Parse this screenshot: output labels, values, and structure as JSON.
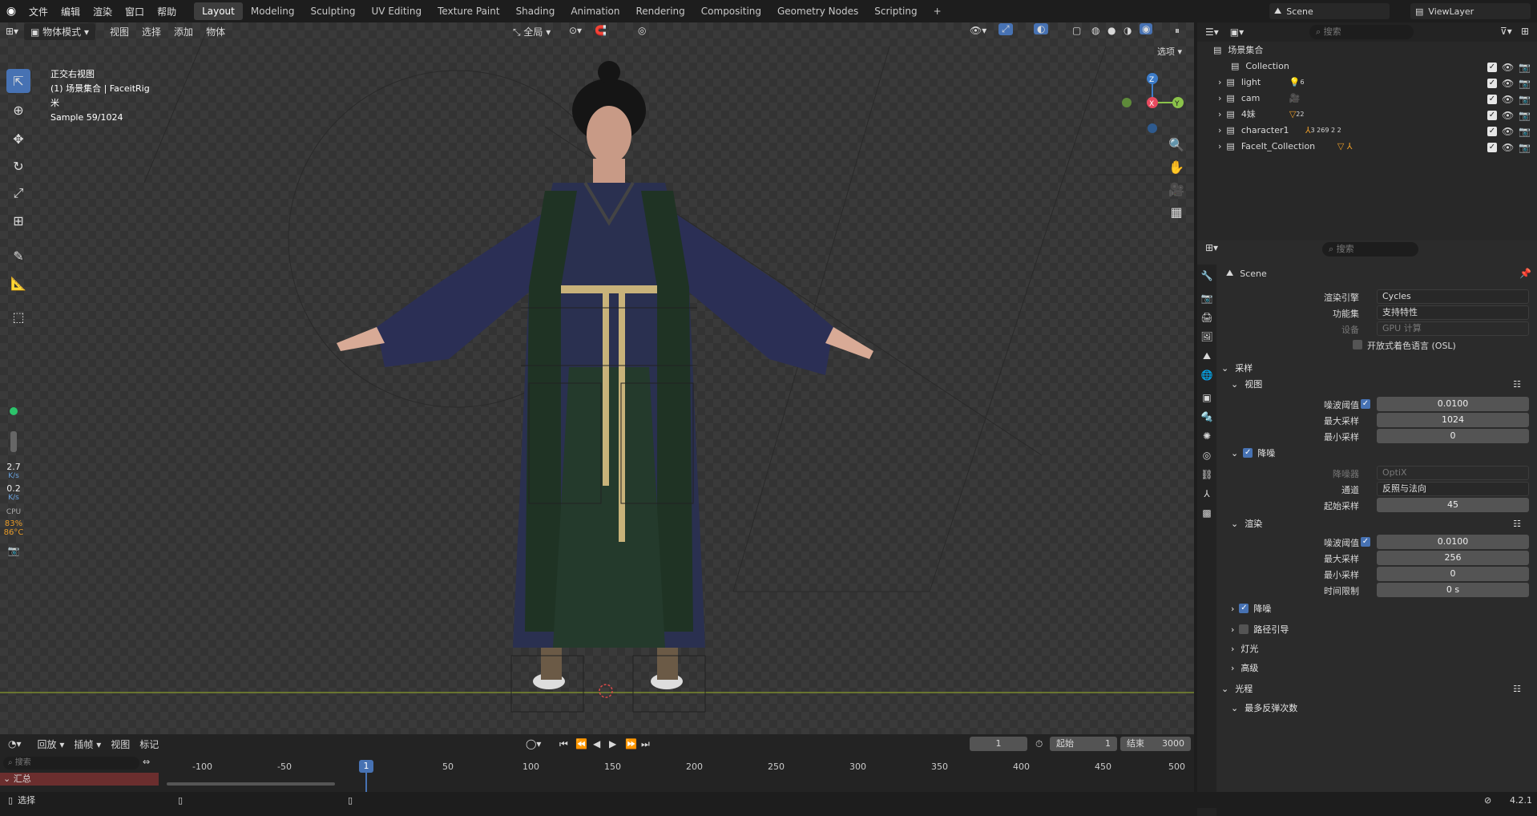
{
  "topbar": {
    "menus": [
      "文件",
      "编辑",
      "渲染",
      "窗口",
      "帮助"
    ],
    "workspaces": [
      "Layout",
      "Modeling",
      "Sculpting",
      "UV Editing",
      "Texture Paint",
      "Shading",
      "Animation",
      "Rendering",
      "Compositing",
      "Geometry Nodes",
      "Scripting"
    ],
    "active_workspace": "Layout",
    "add_tab": "+",
    "scene_name": "Scene",
    "view_layer": "ViewLayer"
  },
  "viewport_header": {
    "mode": "物体模式",
    "menus": [
      "视图",
      "选择",
      "添加",
      "物体"
    ],
    "transform": "全局",
    "options": "选项"
  },
  "hud": {
    "view": "正交右视图",
    "collection": "(1) 场景集合 | FaceitRig",
    "unit": "米",
    "sample": "Sample 59/1024"
  },
  "stats": {
    "net_down": "2.7",
    "net_down_unit": "K/s",
    "net_up": "0.2",
    "net_up_unit": "K/s",
    "cpu_label": "CPU",
    "cpu_percent": "83%",
    "cpu_temp": "86°C"
  },
  "outliner": {
    "search_placeholder": "搜索",
    "root": "场景集合",
    "items": [
      {
        "name": "Collection",
        "badge": ""
      },
      {
        "name": "light",
        "badge": "6"
      },
      {
        "name": "cam",
        "badge": ""
      },
      {
        "name": "4妹",
        "badge": "22"
      },
      {
        "name": "character1",
        "badge": "3 269 2 2"
      },
      {
        "name": "FaceIt_Collection",
        "badge": ""
      }
    ]
  },
  "properties": {
    "search_placeholder": "搜索",
    "scene_title": "Scene",
    "render_engine_label": "渲染引擎",
    "render_engine": "Cycles",
    "feature_set_label": "功能集",
    "feature_set": "支持特性",
    "device_label": "设备",
    "device": "GPU 计算",
    "osl_label": "开放式着色语言 (OSL)",
    "sampling": "采样",
    "viewport": "视图",
    "noise_threshold_label": "噪波阈值",
    "vp_noise_threshold": "0.0100",
    "max_samples_label": "最大采样",
    "vp_max_samples": "1024",
    "min_samples_label": "最小采样",
    "vp_min_samples": "0",
    "denoise": "降噪",
    "denoiser_label": "降噪器",
    "denoiser": "OptiX",
    "passes_label": "通道",
    "passes": "反照与法向",
    "start_sample_label": "起始采样",
    "start_sample": "45",
    "render": "渲染",
    "r_noise_threshold": "0.0100",
    "r_max_samples": "256",
    "r_min_samples": "0",
    "time_limit_label": "时间限制",
    "time_limit": "0 s",
    "render_denoise": "降噪",
    "path_guiding": "路径引导",
    "lights": "灯光",
    "advanced": "高级",
    "light_paths": "光程",
    "max_bounces": "最多反弹次数"
  },
  "timeline": {
    "menus": [
      "回放",
      "插帧",
      "视图",
      "标记"
    ],
    "current_frame": "1",
    "start_label": "起始",
    "start": "1",
    "end_label": "结束",
    "end": "3000",
    "search_placeholder": "搜索",
    "summary": "汇总",
    "ticks": [
      "-100",
      "-50",
      "1",
      "50",
      "100",
      "150",
      "200",
      "250",
      "300",
      "350",
      "400",
      "450",
      "500"
    ]
  },
  "statusbar": {
    "select": "选择",
    "version": "4.2.1"
  },
  "colors": {
    "accent": "#4772b3",
    "axis_x": "#e84a5f",
    "axis_y": "#8bc34a",
    "axis_z": "#3d7cc9",
    "cpu": "#e69a28"
  }
}
